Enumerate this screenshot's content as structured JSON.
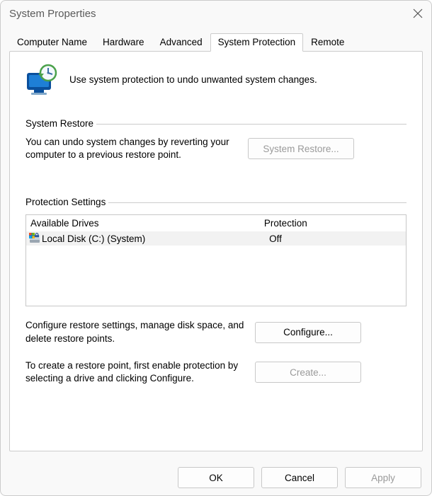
{
  "window": {
    "title": "System Properties"
  },
  "tabs": {
    "items": [
      {
        "label": "Computer Name"
      },
      {
        "label": "Hardware"
      },
      {
        "label": "Advanced"
      },
      {
        "label": "System Protection"
      },
      {
        "label": "Remote"
      }
    ],
    "active_index": 3
  },
  "header": {
    "message": "Use system protection to undo unwanted system changes."
  },
  "system_restore": {
    "group_label": "System Restore",
    "description": "You can undo system changes by reverting your computer to a previous restore point.",
    "button_label": "System Restore...",
    "button_enabled": false
  },
  "protection_settings": {
    "group_label": "Protection Settings",
    "columns": {
      "drive": "Available Drives",
      "protection": "Protection"
    },
    "drives": [
      {
        "name": "Local Disk (C:) (System)",
        "protection": "Off"
      }
    ],
    "configure": {
      "description": "Configure restore settings, manage disk space, and delete restore points.",
      "button_label": "Configure...",
      "button_enabled": true
    },
    "create": {
      "description": "To create a restore point, first enable protection by selecting a drive and clicking Configure.",
      "button_label": "Create...",
      "button_enabled": false
    }
  },
  "footer": {
    "ok": "OK",
    "cancel": "Cancel",
    "apply": "Apply",
    "apply_enabled": false
  }
}
